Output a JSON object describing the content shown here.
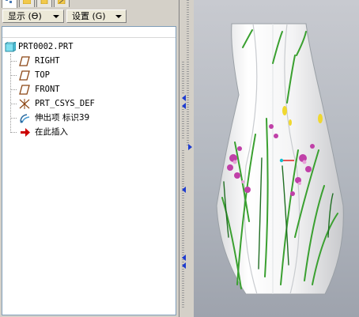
{
  "toolbar": {
    "show_label": "显示 (Ɵ)",
    "settings_label": "设置 (G)"
  },
  "tree": {
    "root": "PRT0002.PRT",
    "items": [
      {
        "label": "RIGHT",
        "icon": "datum-plane-icon"
      },
      {
        "label": "TOP",
        "icon": "datum-plane-icon"
      },
      {
        "label": "FRONT",
        "icon": "datum-plane-icon"
      },
      {
        "label": "PRT_CSYS_DEF",
        "icon": "csys-icon"
      },
      {
        "label": "伸出项 标识39",
        "icon": "protrusion-icon"
      },
      {
        "label": "在此插入",
        "icon": "insert-here-arrow-icon"
      }
    ]
  },
  "colors": {
    "panel": "#d4d0c8",
    "tree_bg": "#ffffff",
    "datum_plane": "#8b4513",
    "insert_arrow": "#cc0000",
    "viewport_top": "#c8cad0",
    "viewport_bottom": "#9ea3ad",
    "csys_x": "#e01010",
    "csys_y": "#10c0d0"
  }
}
